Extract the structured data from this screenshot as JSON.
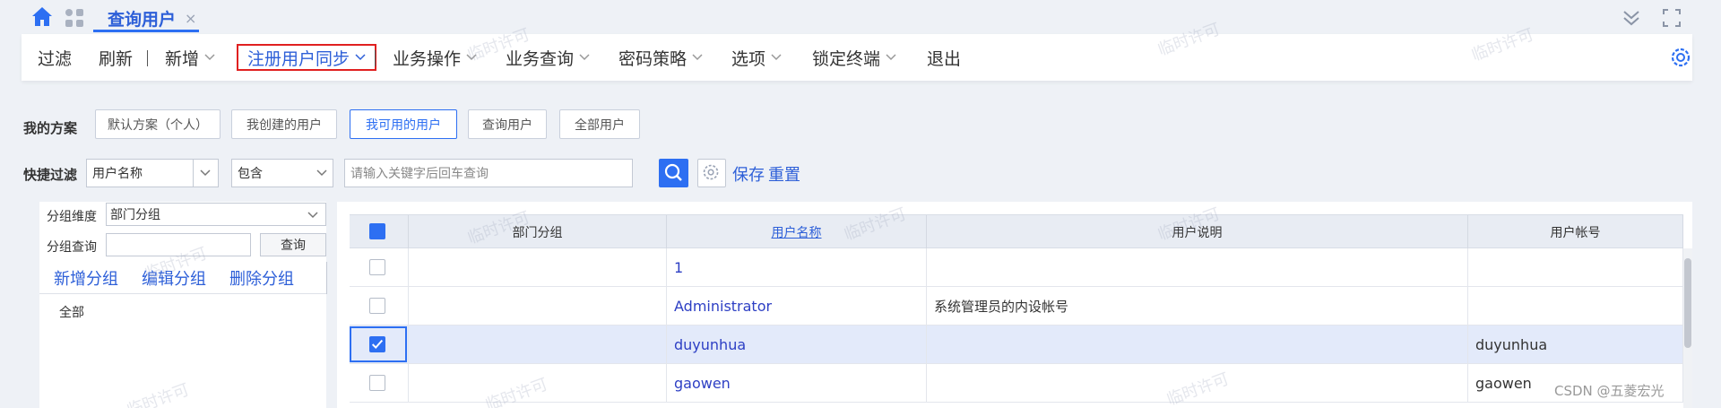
{
  "tabs": {
    "active_label": "查询用户",
    "close": "×"
  },
  "toolbar": {
    "items": [
      "过滤",
      "刷新",
      "新增",
      "注册用户同步",
      "业务操作",
      "业务查询",
      "密码策略",
      "选项",
      "锁定终端",
      "退出"
    ]
  },
  "schemes": {
    "label": "我的方案",
    "buttons": [
      "默认方案（个人）",
      "我创建的用户",
      "我可用的用户",
      "查询用户",
      "全部用户"
    ],
    "active_index": 2
  },
  "quick_filter": {
    "label": "快捷过滤",
    "field": "用户名称",
    "operator": "包含",
    "keyword_placeholder": "请输入关键字后回车查询",
    "save": "保存",
    "reset": "重置"
  },
  "group_panel": {
    "dimension_label": "分组维度",
    "dimension_value": "部门分组",
    "query_label": "分组查询",
    "query_button": "查询",
    "add": "新增分组",
    "edit": "编辑分组",
    "delete": "删除分组",
    "tree_root": "全部"
  },
  "grid": {
    "columns": [
      "部门分组",
      "用户名称",
      "用户说明",
      "用户帐号"
    ],
    "rows": [
      {
        "group": "",
        "name": "1",
        "desc": "",
        "account": "",
        "checked": false
      },
      {
        "group": "",
        "name": "Administrator",
        "desc": "系统管理员的内设帐号",
        "account": "",
        "checked": false
      },
      {
        "group": "",
        "name": "duyunhua",
        "desc": "",
        "account": "duyunhua",
        "checked": true
      },
      {
        "group": "",
        "name": "gaowen",
        "desc": "",
        "account": "gaowen",
        "checked": false
      }
    ]
  },
  "watermark": "临时许可",
  "footer": "CSDN @五菱宏光",
  "colors": {
    "accent": "#2d6ff2",
    "highlight_border": "#e02020"
  }
}
